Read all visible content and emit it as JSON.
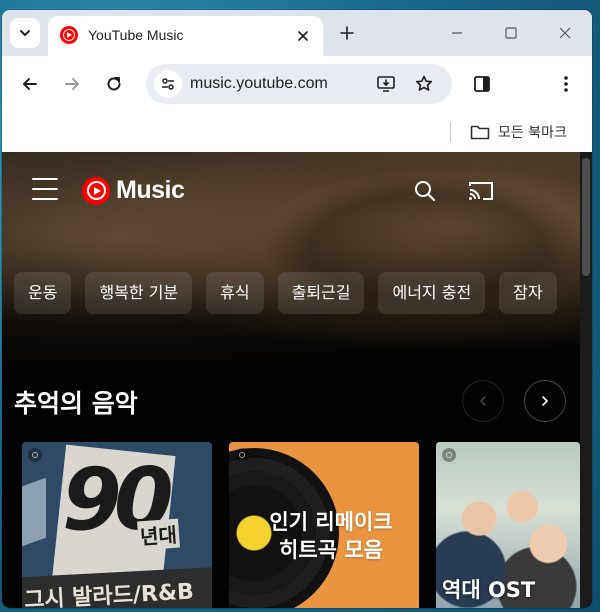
{
  "browser": {
    "tab_title": "YouTube Music",
    "url": "music.youtube.com",
    "bookmarks_folder": "모든 북마크"
  },
  "app": {
    "logo_text": "Music",
    "brand_color": "#ff0000",
    "chips": [
      "운동",
      "행복한 기분",
      "휴식",
      "출퇴근길",
      "에너지 충전",
      "잠자"
    ],
    "section_title": "추억의 음악",
    "cards": [
      {
        "art_title": "90",
        "art_subtitle": "년대",
        "art_genre": "그시 발라드/R&B"
      },
      {
        "art_title_line1": "인기 리메이크",
        "art_title_line2": "히트곡 모음"
      },
      {
        "art_title": "역대 OST"
      }
    ]
  },
  "icons": {
    "tab_search": "chevron-down-icon",
    "favicon": "youtube-music-icon",
    "tab_close": "close-icon",
    "new_tab": "plus-icon",
    "minimize": "minimize-icon",
    "maximize": "maximize-icon",
    "window_close": "close-icon",
    "back": "arrow-left-icon",
    "forward": "arrow-right-icon",
    "reload": "reload-icon",
    "site_info": "tune-icon",
    "install": "install-app-icon",
    "bookmark_star": "star-icon",
    "side_panel": "side-panel-icon",
    "menu": "more-vert-icon",
    "folder": "folder-icon",
    "hamburger": "menu-icon",
    "search": "search-icon",
    "cast": "cast-icon",
    "carousel_prev": "chevron-left-icon",
    "carousel_next": "chevron-right-icon"
  }
}
